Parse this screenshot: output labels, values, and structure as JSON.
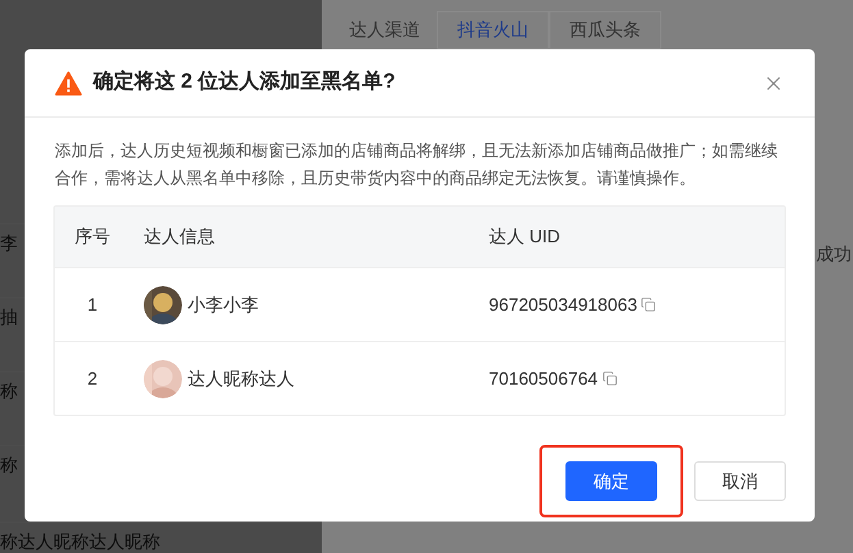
{
  "background": {
    "left_fragments": [
      "李",
      "抽",
      "称",
      "称",
      "称达人昵称达人昵称"
    ],
    "channel_label": "达人渠道",
    "channel_tabs": [
      {
        "label": "抖音火山",
        "selected": true
      },
      {
        "label": "西瓜头条",
        "selected": false
      }
    ],
    "status_fragment": "成功"
  },
  "dialog": {
    "title": "确定将这 2 位达人添加至黑名单?",
    "message": "添加后，达人历史短视频和橱窗已添加的店铺商品将解绑，且无法新添加店铺商品做推广；如需继续合作，需将达人从黑名单中移除，且历史带货内容中的商品绑定无法恢复。请谨慎操作。",
    "table": {
      "columns": [
        "序号",
        "达人信息",
        "达人 UID"
      ],
      "rows": [
        {
          "index": "1",
          "name": "小李小李",
          "uid": "967205034918063"
        },
        {
          "index": "2",
          "name": "达人昵称达人",
          "uid": "70160506764"
        }
      ]
    },
    "buttons": [
      {
        "label": "确定",
        "kind": "primary",
        "highlighted": true
      },
      {
        "label": "取消",
        "kind": "default",
        "highlighted": false
      }
    ]
  }
}
